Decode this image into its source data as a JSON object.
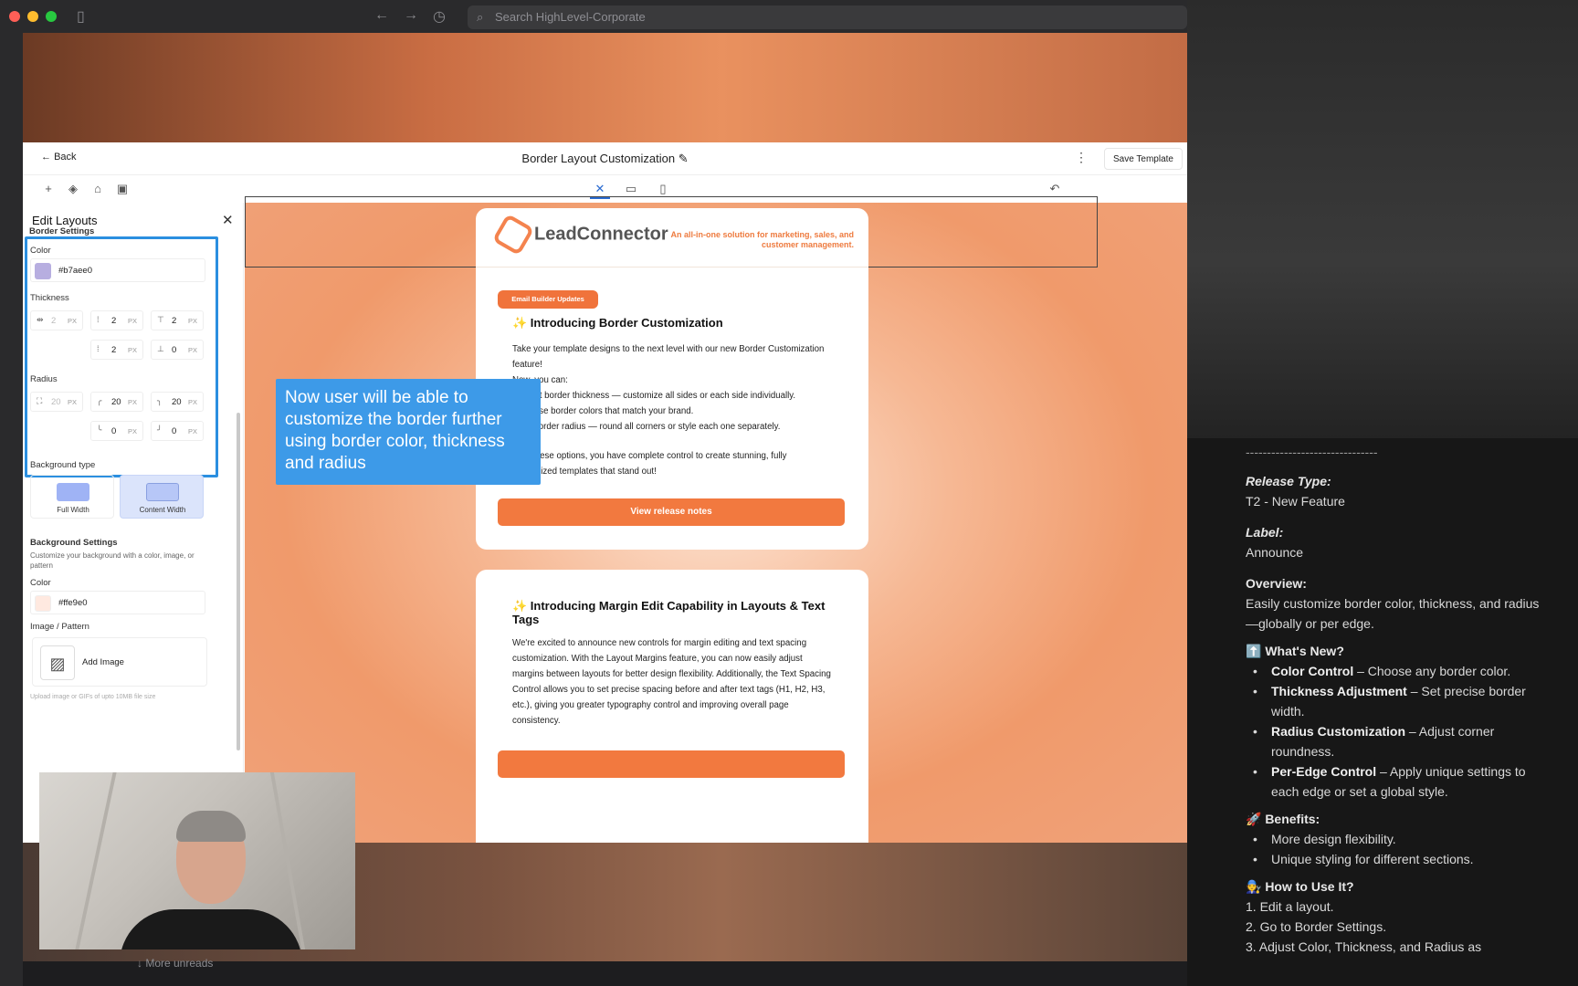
{
  "macbar": {
    "search_placeholder": "Search HighLevel-Corporate"
  },
  "header": {
    "back": "Back",
    "title": "Border Layout Customization",
    "save": "Save Template"
  },
  "left_panel": {
    "title": "Edit Layouts",
    "border_settings": "Border Settings",
    "color_label": "Color",
    "color_hex": "#b7aee0",
    "thickness_label": "Thickness",
    "thickness": [
      "2",
      "2",
      "2",
      "2",
      "0"
    ],
    "radius_label": "Radius",
    "radius": [
      "20",
      "20",
      "20",
      "0",
      "0"
    ],
    "unit": "PX",
    "bg_type_label": "Background type",
    "bg_full": "Full Width",
    "bg_content": "Content Width",
    "bg_settings": "Background Settings",
    "bg_settings_desc": "Customize your background with a color, image, or pattern",
    "bg_color_label": "Color",
    "bg_color_hex": "#ffe9e0",
    "image_label": "Image / Pattern",
    "add_image": "Add Image",
    "upload_hint": "Upload image or GIFs of upto 10MB file size"
  },
  "tooltip": "Now user will be able to customize the border further using border color, thickness and radius",
  "email": {
    "logo": "LeadConnector",
    "tagline": "An all-in-one solution for marketing, sales, and customer management.",
    "badge": "Email Builder Updates",
    "h1": "✨ Introducing Border Customization",
    "p1": "Take your template designs to the next level with our new Border Customization feature!",
    "p2": "Now, you can:",
    "b1": "• Adjust border thickness — customize all sides or each side individually.",
    "b2": "• Choose border colors that match your brand.",
    "b3": "• Set border radius — round all corners or style each one separately.",
    "p3": "With these options, you have complete control to create stunning, fully customized templates that stand out!",
    "cta": "View release notes",
    "h2": "✨ Introducing Margin Edit Capability in Layouts & Text Tags",
    "p4": "We're excited to announce new controls for margin editing and text spacing customization. With the Layout Margins feature, you can now easily adjust margins between layouts for better design flexibility. Additionally, the Text Spacing Control allows you to set precise spacing before and after text tags (H1, H2, H3, etc.), giving you greater typography control and improving overall page consistency."
  },
  "notes": {
    "dashes": "-------------------------------",
    "release_type_label": "Release Type:",
    "release_type": "T2 - New Feature",
    "label_label": "Label:",
    "label": "Announce",
    "overview_label": "Overview:",
    "overview": "Easily customize border color, thickness, and radius—globally or per edge.",
    "whats_new": "⬆️ What's New?",
    "wn": [
      {
        "b": "Color Control",
        "t": " – Choose any border color."
      },
      {
        "b": "Thickness Adjustment",
        "t": " – Set precise border width."
      },
      {
        "b": "Radius Customization",
        "t": " – Adjust corner roundness."
      },
      {
        "b": "Per-Edge Control",
        "t": " – Apply unique settings to each edge or set a global style."
      }
    ],
    "benefits": "🚀 Benefits:",
    "bn": [
      "More design flexibility.",
      "Unique styling for different sections."
    ],
    "howto": "🧑‍🔧 How to Use It?",
    "steps": [
      "1.   Edit a layout.",
      "2.   Go to Border Settings.",
      "3.   Adjust Color, Thickness, and Radius as"
    ]
  },
  "under_text": "↓ More unreads"
}
